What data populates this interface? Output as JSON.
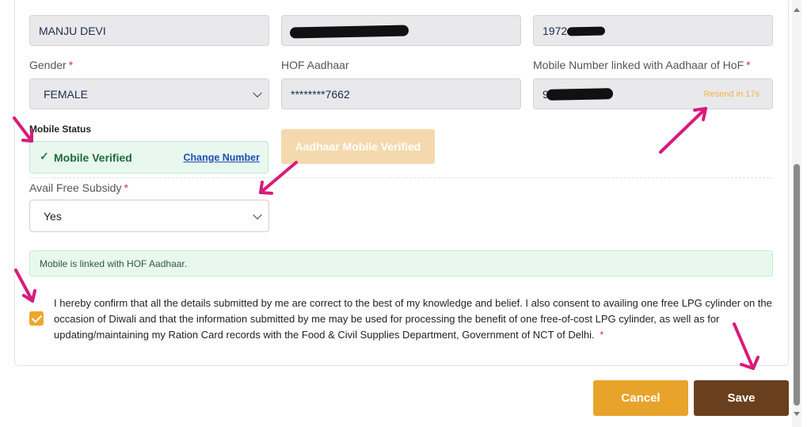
{
  "fields": {
    "name_value": "MANJU DEVI",
    "dob_value": "1972-",
    "gender_label": "Gender",
    "gender_value": "FEMALE",
    "hof_aadhaar_label": "HOF Aadhaar",
    "hof_aadhaar_value": "********7662",
    "mobile_label": "Mobile Number linked with Aadhaar of HoF",
    "mobile_value": "95",
    "resend_text": "Resend in 17s",
    "required_mark": "*"
  },
  "mobile_status": {
    "title": "Mobile Status",
    "verified_text": "Mobile Verified",
    "change_link": "Change Number",
    "aadhaar_button": "Aadhaar Mobile Verified"
  },
  "subsidy": {
    "label": "Avail Free Subsidy",
    "value": "Yes"
  },
  "info_message": "Mobile is linked with HOF Aadhaar.",
  "consent": {
    "checked": true,
    "text": "I hereby confirm that all the details submitted by me are correct to the best of my knowledge and belief. I also consent to availing one free LPG cylinder on the occasion of Diwali and that the information submitted by me may be used for processing the benefit of one free-of-cost LPG cylinder, as well as for updating/maintaining my Ration Card records with the Food & Civil Supplies Department, Government of NCT of Delhi."
  },
  "actions": {
    "cancel_label": "Cancel",
    "save_label": "Save"
  },
  "colors": {
    "accent_orange": "#e8a32b",
    "save_brown": "#6a3f1d",
    "annotation_arrow": "#d81b7a"
  }
}
